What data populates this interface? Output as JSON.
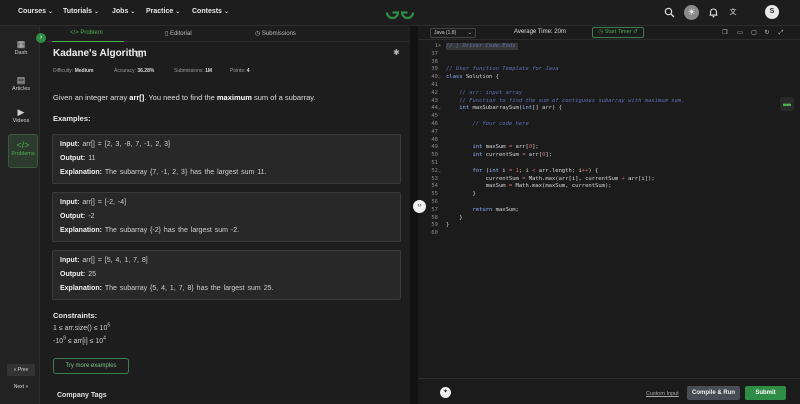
{
  "nav": {
    "items": [
      "Courses",
      "Tutorials",
      "Jobs",
      "Practice",
      "Contests"
    ],
    "user_initial": "S"
  },
  "sidebar": {
    "items": [
      "Dash",
      "Articles",
      "Videos",
      "Problems"
    ],
    "prev": "« Prev",
    "next": "Next »"
  },
  "tabs": [
    "Problem",
    "Editorial",
    "Submissions"
  ],
  "problem": {
    "title": "Kadane's Algorithm",
    "meta": [
      {
        "label": "Difficulty:",
        "value": "Medium"
      },
      {
        "label": "Accuracy:",
        "value": "36.28%"
      },
      {
        "label": "Submissions:",
        "value": "1M"
      },
      {
        "label": "Points:",
        "value": "4"
      }
    ],
    "statement": {
      "p1": "Given an integer array ",
      "arr": "arr[]",
      "p2": ". You need to find the ",
      "bold": "maximum",
      "p3": " sum of a subarray."
    },
    "examples_heading": "Examples:",
    "examples": [
      {
        "input": "arr[] = [2, 3, -8, 7, -1, 2, 3]",
        "output": "11",
        "explanation": "The subarray {7, -1, 2, 3} has the largest sum 11."
      },
      {
        "input": "arr[] = [-2, -4]",
        "output": "-2",
        "explanation": "The subarray {-2} has the largest sum -2."
      },
      {
        "input": "arr[] = [5, 4, 1, 7, 8]",
        "output": "25",
        "explanation": "The subarray {5, 4, 1, 7, 8} has the largest sum 25."
      }
    ],
    "labels": {
      "input": "Input:",
      "output": "Output:",
      "explanation": "Explanation:"
    },
    "constraints_heading": "Constraints:",
    "constraints": [
      {
        "pre": "1 ≤ arr.size() ≤ 10",
        "sup": "5",
        "post": "",
        "presup": ""
      },
      {
        "pre": "-10",
        "presup": "9",
        "post": " ≤ arr[i] ≤ 10",
        "sup": "4"
      }
    ],
    "more_examples": "Try more examples",
    "company_tags": "Company Tags"
  },
  "editor": {
    "language": "Java (1.8)",
    "avg_time": "Average Time: 20m",
    "start_timer": "Start Timer",
    "custom_input": "Custom Input",
    "compile_run": "Compile & Run",
    "submit": "Submit",
    "lines": [
      {
        "n": "1",
        "fold": "+",
        "html": "<span class='c-com'>// } Driver Code Ends</span>"
      },
      {
        "n": "37",
        "fold": "",
        "html": ""
      },
      {
        "n": "38",
        "fold": "",
        "html": ""
      },
      {
        "n": "39",
        "fold": "",
        "html": "<span class='c-com'>// User function Template for Java</span>"
      },
      {
        "n": "40",
        "fold": "⌄",
        "html": "<span class='c-kw'>class</span> Solution {"
      },
      {
        "n": "41",
        "fold": "",
        "html": ""
      },
      {
        "n": "42",
        "fold": "",
        "html": "    <span class='c-com'>// arr: input array</span>"
      },
      {
        "n": "43",
        "fold": "",
        "html": "    <span class='c-com'>// Function to find the sum of contiguous subarray with maximum sum.</span>"
      },
      {
        "n": "44",
        "fold": "⌄",
        "html": "    <span class='c-kw'>int</span> maxSubarraySum(<span class='c-kw'>int</span>[] arr) {"
      },
      {
        "n": "45",
        "fold": "",
        "html": ""
      },
      {
        "n": "46",
        "fold": "",
        "html": "        <span class='c-com'>// Your code here</span>"
      },
      {
        "n": "47",
        "fold": "",
        "html": ""
      },
      {
        "n": "48",
        "fold": "",
        "html": ""
      },
      {
        "n": "49",
        "fold": "",
        "html": "        <span class='c-kw'>int</span> maxSum <span class='c-op'>=</span> arr[<span class='c-num'>0</span>];"
      },
      {
        "n": "50",
        "fold": "",
        "html": "        <span class='c-kw'>int</span> currentSum <span class='c-op'>=</span> arr[<span class='c-num'>0</span>];"
      },
      {
        "n": "51",
        "fold": "",
        "html": ""
      },
      {
        "n": "52",
        "fold": "⌄",
        "html": "        <span class='c-kw'>for</span> (<span class='c-kw'>int</span> i <span class='c-op'>=</span> <span class='c-num'>1</span>; i <span class='c-op'>&lt;</span> arr.length; i<span class='c-op'>++</span>) {"
      },
      {
        "n": "53",
        "fold": "",
        "html": "            currentSum <span class='c-op'>=</span> Math.max(arr[i], currentSum <span class='c-op'>+</span> arr[i]);"
      },
      {
        "n": "54",
        "fold": "",
        "html": "            maxSum <span class='c-op'>=</span> Math.max(maxSum, currentSum);"
      },
      {
        "n": "55",
        "fold": "",
        "html": "        }"
      },
      {
        "n": "56",
        "fold": "",
        "html": ""
      },
      {
        "n": "57",
        "fold": "",
        "html": "        <span class='c-kw'>return</span> maxSum;"
      },
      {
        "n": "58",
        "fold": "",
        "html": "    }"
      },
      {
        "n": "59",
        "fold": "",
        "html": "}"
      },
      {
        "n": "60",
        "fold": "",
        "html": ""
      }
    ]
  },
  "colors": {
    "accent": "#2f8d46",
    "background": "#1b1b1b"
  }
}
